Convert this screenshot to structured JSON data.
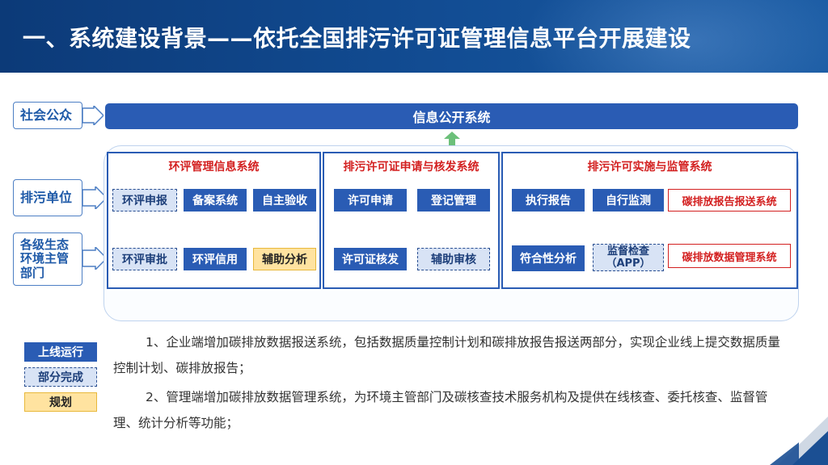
{
  "header": {
    "title": "一、系统建设背景——依托全国排污许可证管理信息平台开展建设"
  },
  "sides": {
    "public": "社会公众",
    "enterprise": "排污单位",
    "gov_line1": "各级生态",
    "gov_line2": "环境主管",
    "gov_line3": "部门"
  },
  "info_bar": {
    "label": "信息公开系统"
  },
  "panels": {
    "eia": {
      "title": "环评管理信息系统",
      "modules": [
        "环评申报",
        "备案系统",
        "自主验收",
        "环评审批",
        "环评信用",
        "辅助分析"
      ]
    },
    "permit": {
      "title": "排污许可证申请与核发系统",
      "modules": [
        "许可申请",
        "登记管理",
        "许可证核发",
        "辅助审核"
      ]
    },
    "supervision": {
      "title": "排污许可实施与监管系统",
      "modules": [
        "执行报告",
        "自行监测",
        "碳排放报告报送系统",
        "符合性分析",
        "监督检查",
        "（APP）",
        "碳排放数据管理系统"
      ]
    }
  },
  "legend": {
    "online": "上线运行",
    "partial": "部分完成",
    "planned": "规划"
  },
  "notes": {
    "p1": "1、企业端增加碳排放数据报送系统，包括数据质量控制计划和碳排放报告报送两部分，实现企业线上提交数据质量控制计划、碳排放报告；",
    "p2": "2、管理端增加碳排放数据管理系统，为环境主管部门及碳核查技术服务机构及提供在线核查、委托核查、监督管理、统计分析等功能；"
  },
  "colors": {
    "header": "#124d94",
    "online": "#2a5cb4",
    "partial": "#d8e3f5",
    "planned": "#ffe3a0",
    "accent_red": "#d32020"
  }
}
